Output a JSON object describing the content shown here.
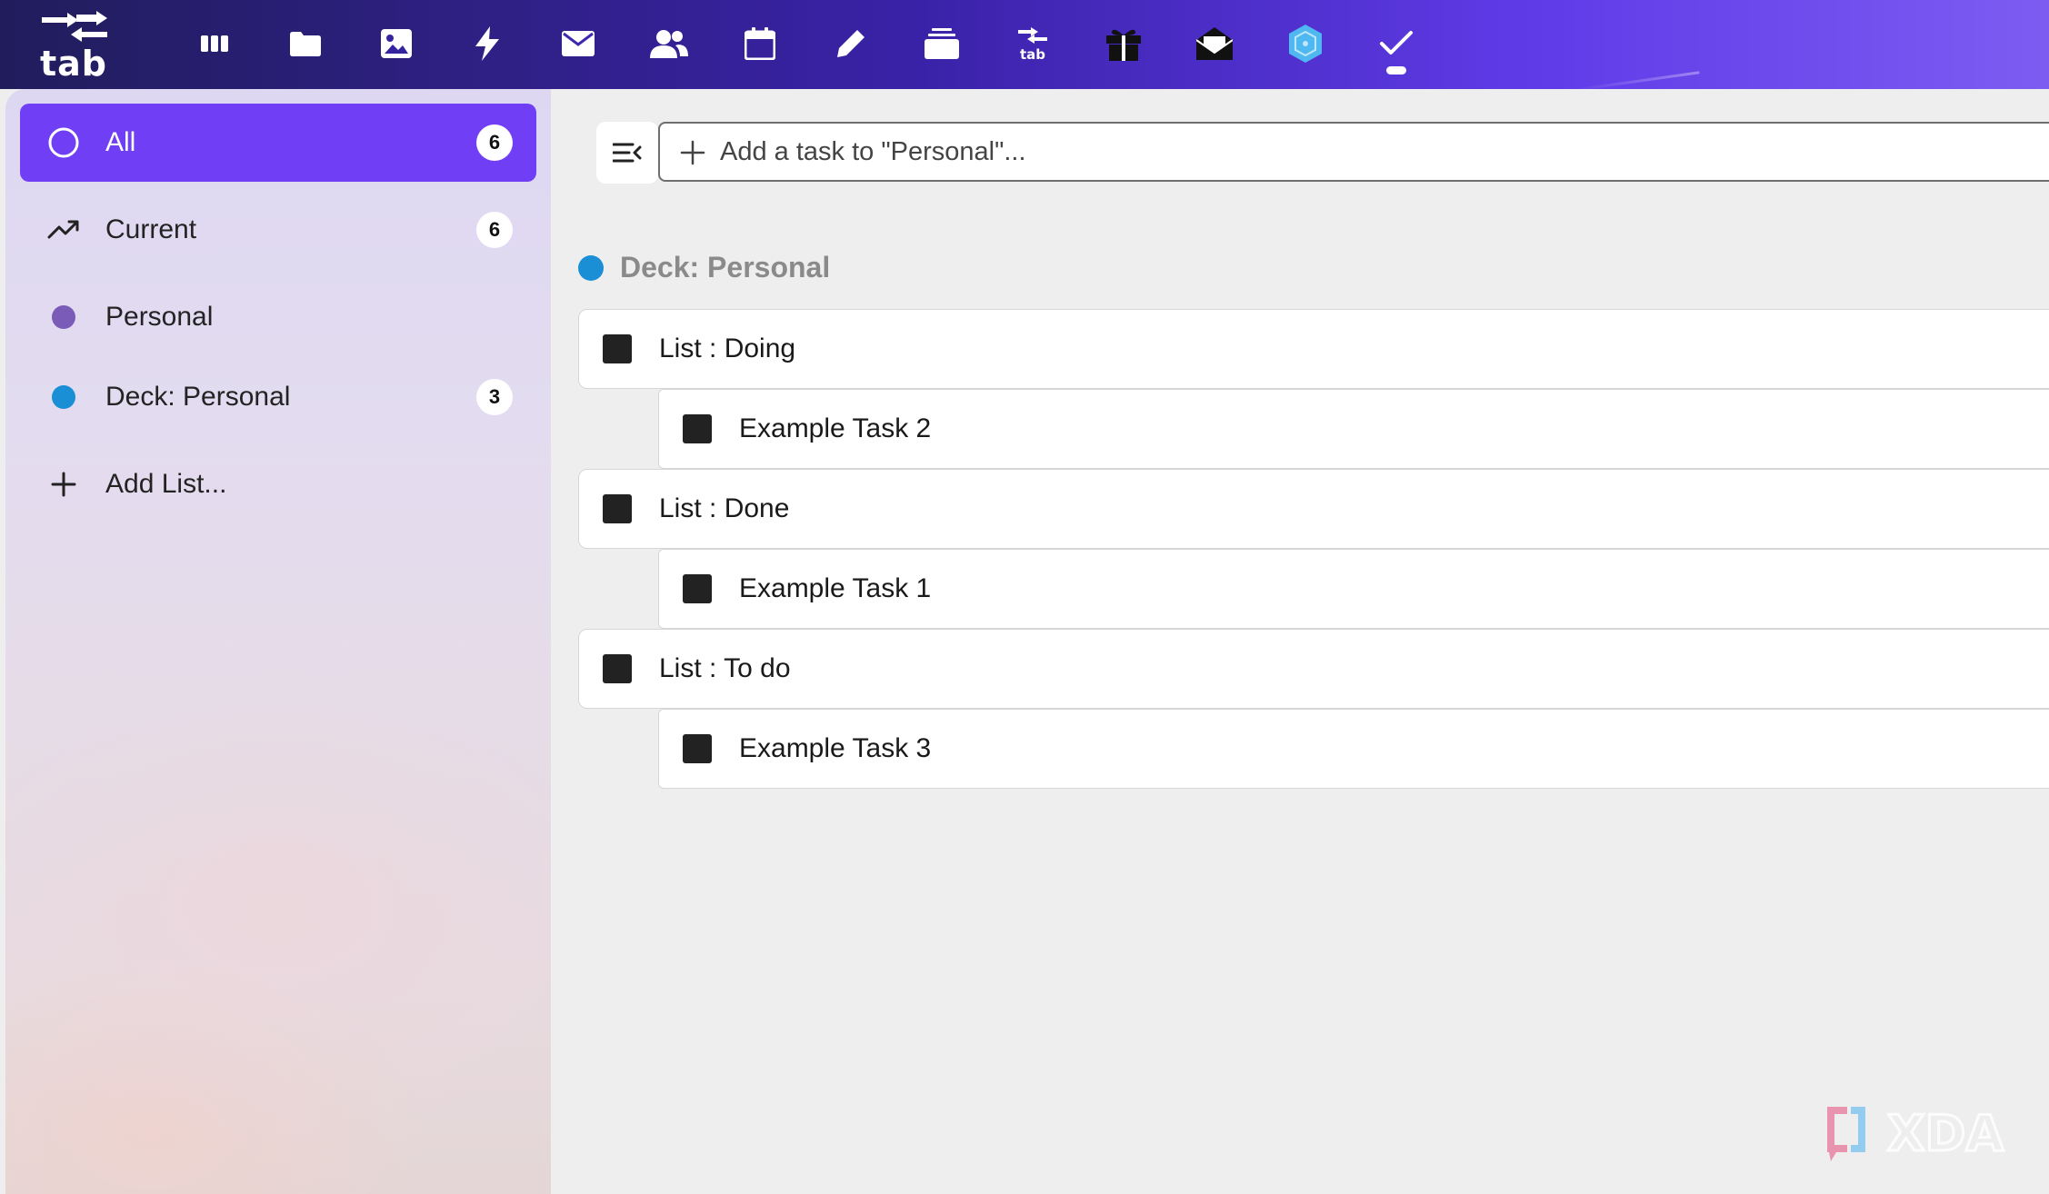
{
  "brand": {
    "logo_text": "tab"
  },
  "colors": {
    "accent": "#6f3ef5",
    "personal_dot": "#7a5bb8",
    "deck_dot": "#1a8fd6",
    "hex_icon": "#4fb8f0"
  },
  "topbar": {
    "icons": [
      {
        "name": "columns-icon"
      },
      {
        "name": "folder-icon"
      },
      {
        "name": "image-icon"
      },
      {
        "name": "lightning-icon"
      },
      {
        "name": "mail-icon"
      },
      {
        "name": "contacts-icon"
      },
      {
        "name": "calendar-icon"
      },
      {
        "name": "pencil-icon"
      },
      {
        "name": "stack-icon"
      },
      {
        "name": "tab-transfer-icon",
        "label": "tab"
      },
      {
        "name": "gift-icon"
      },
      {
        "name": "mail-open-icon"
      },
      {
        "name": "hexagon-app-icon"
      },
      {
        "name": "tasks-check-icon",
        "active": true
      }
    ]
  },
  "sidebar": {
    "items": [
      {
        "label": "All",
        "count": "6",
        "active": true,
        "icon": "circle-outline-icon"
      },
      {
        "label": "Current",
        "count": "6",
        "icon": "trending-up-icon"
      },
      {
        "label": "Personal",
        "icon": "dot-icon"
      },
      {
        "label": "Deck: Personal",
        "count": "3",
        "icon": "dot-icon"
      },
      {
        "label": "Add List...",
        "icon": "plus-icon"
      }
    ]
  },
  "main": {
    "add_task_placeholder": "Add a task to \"Personal\"...",
    "deck_title": "Deck: Personal",
    "rows": [
      {
        "type": "list",
        "label": "List : Doing"
      },
      {
        "type": "task",
        "label": "Example Task 2"
      },
      {
        "type": "list",
        "label": "List : Done"
      },
      {
        "type": "task",
        "label": "Example Task 1"
      },
      {
        "type": "list",
        "label": "List : To do"
      },
      {
        "type": "task",
        "label": "Example Task 3"
      }
    ]
  },
  "watermark": {
    "text": "XDA"
  }
}
